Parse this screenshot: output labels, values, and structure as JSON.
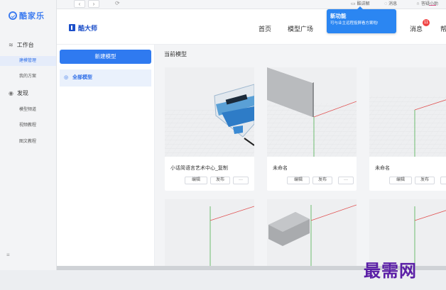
{
  "topbar": {
    "back": "‹",
    "forward": "›",
    "refresh": "⟳",
    "live_label": "酷讲解",
    "msg_label": "消息",
    "help_label": "答疑小助"
  },
  "sidebar": {
    "brand": "酷家乐",
    "sections": [
      {
        "label": "工作台",
        "icon": "wifi-icon"
      },
      {
        "label": "发现",
        "icon": "compass-icon"
      }
    ],
    "items": [
      {
        "label": "建模管理",
        "active": true
      },
      {
        "label": "我的方案",
        "active": false
      },
      {
        "label": "模型频道",
        "active": false
      },
      {
        "label": "视频教程",
        "active": false
      },
      {
        "label": "图文教程",
        "active": false
      }
    ],
    "menu_icon": "≡"
  },
  "header": {
    "title": "酷大师",
    "nav": [
      "首页",
      "模型广场",
      "消息",
      "帮"
    ],
    "badge_count": "11"
  },
  "tooltip": {
    "title": "新功能",
    "text": "可与业主远程投屏看方案啦!"
  },
  "left_panel": {
    "new_button": "新建模型",
    "all_models": "全部模型"
  },
  "main": {
    "section_title": "当前模型",
    "cards": [
      {
        "name": "小话简语言艺术中心_复制",
        "actions": [
          "编辑",
          "发布",
          "···"
        ]
      },
      {
        "name": "未命名",
        "actions": [
          "编辑",
          "发布",
          "···"
        ]
      },
      {
        "name": "未命名",
        "actions": [
          "编辑",
          "发布",
          "···"
        ]
      }
    ]
  },
  "watermark": "最需网",
  "colors": {
    "accent": "#2f7af0",
    "brand": "#1c4fc9",
    "badge": "#f04343",
    "watermark": "#5a1ea6"
  }
}
